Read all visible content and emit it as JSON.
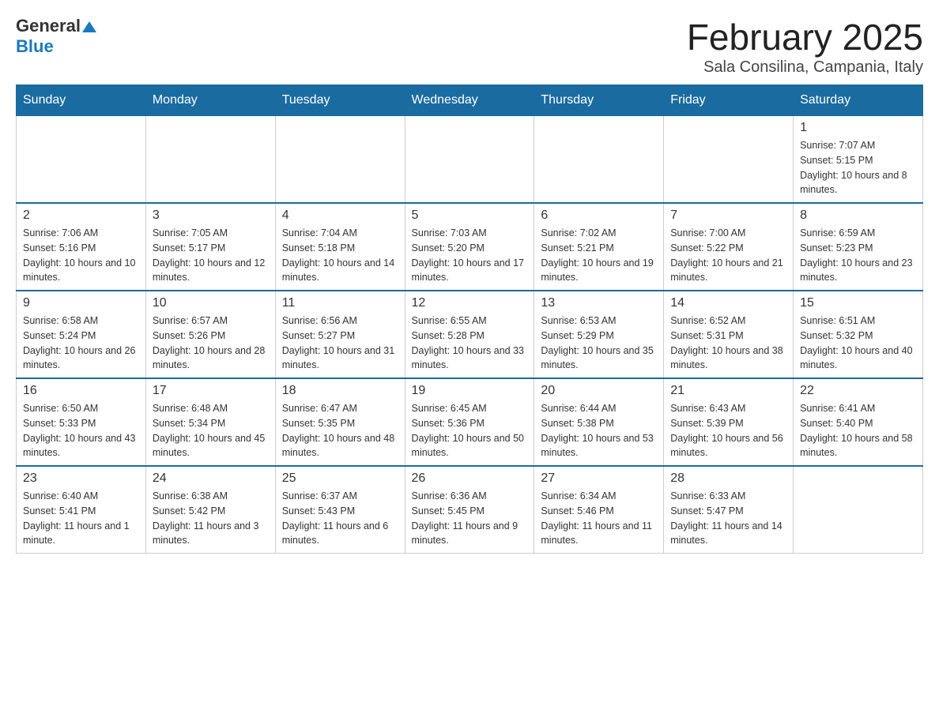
{
  "header": {
    "logo_general": "General",
    "logo_blue": "Blue",
    "month_title": "February 2025",
    "location": "Sala Consilina, Campania, Italy"
  },
  "days_of_week": [
    "Sunday",
    "Monday",
    "Tuesday",
    "Wednesday",
    "Thursday",
    "Friday",
    "Saturday"
  ],
  "weeks": [
    [
      {
        "day": "",
        "info": ""
      },
      {
        "day": "",
        "info": ""
      },
      {
        "day": "",
        "info": ""
      },
      {
        "day": "",
        "info": ""
      },
      {
        "day": "",
        "info": ""
      },
      {
        "day": "",
        "info": ""
      },
      {
        "day": "1",
        "info": "Sunrise: 7:07 AM\nSunset: 5:15 PM\nDaylight: 10 hours and 8 minutes."
      }
    ],
    [
      {
        "day": "2",
        "info": "Sunrise: 7:06 AM\nSunset: 5:16 PM\nDaylight: 10 hours and 10 minutes."
      },
      {
        "day": "3",
        "info": "Sunrise: 7:05 AM\nSunset: 5:17 PM\nDaylight: 10 hours and 12 minutes."
      },
      {
        "day": "4",
        "info": "Sunrise: 7:04 AM\nSunset: 5:18 PM\nDaylight: 10 hours and 14 minutes."
      },
      {
        "day": "5",
        "info": "Sunrise: 7:03 AM\nSunset: 5:20 PM\nDaylight: 10 hours and 17 minutes."
      },
      {
        "day": "6",
        "info": "Sunrise: 7:02 AM\nSunset: 5:21 PM\nDaylight: 10 hours and 19 minutes."
      },
      {
        "day": "7",
        "info": "Sunrise: 7:00 AM\nSunset: 5:22 PM\nDaylight: 10 hours and 21 minutes."
      },
      {
        "day": "8",
        "info": "Sunrise: 6:59 AM\nSunset: 5:23 PM\nDaylight: 10 hours and 23 minutes."
      }
    ],
    [
      {
        "day": "9",
        "info": "Sunrise: 6:58 AM\nSunset: 5:24 PM\nDaylight: 10 hours and 26 minutes."
      },
      {
        "day": "10",
        "info": "Sunrise: 6:57 AM\nSunset: 5:26 PM\nDaylight: 10 hours and 28 minutes."
      },
      {
        "day": "11",
        "info": "Sunrise: 6:56 AM\nSunset: 5:27 PM\nDaylight: 10 hours and 31 minutes."
      },
      {
        "day": "12",
        "info": "Sunrise: 6:55 AM\nSunset: 5:28 PM\nDaylight: 10 hours and 33 minutes."
      },
      {
        "day": "13",
        "info": "Sunrise: 6:53 AM\nSunset: 5:29 PM\nDaylight: 10 hours and 35 minutes."
      },
      {
        "day": "14",
        "info": "Sunrise: 6:52 AM\nSunset: 5:31 PM\nDaylight: 10 hours and 38 minutes."
      },
      {
        "day": "15",
        "info": "Sunrise: 6:51 AM\nSunset: 5:32 PM\nDaylight: 10 hours and 40 minutes."
      }
    ],
    [
      {
        "day": "16",
        "info": "Sunrise: 6:50 AM\nSunset: 5:33 PM\nDaylight: 10 hours and 43 minutes."
      },
      {
        "day": "17",
        "info": "Sunrise: 6:48 AM\nSunset: 5:34 PM\nDaylight: 10 hours and 45 minutes."
      },
      {
        "day": "18",
        "info": "Sunrise: 6:47 AM\nSunset: 5:35 PM\nDaylight: 10 hours and 48 minutes."
      },
      {
        "day": "19",
        "info": "Sunrise: 6:45 AM\nSunset: 5:36 PM\nDaylight: 10 hours and 50 minutes."
      },
      {
        "day": "20",
        "info": "Sunrise: 6:44 AM\nSunset: 5:38 PM\nDaylight: 10 hours and 53 minutes."
      },
      {
        "day": "21",
        "info": "Sunrise: 6:43 AM\nSunset: 5:39 PM\nDaylight: 10 hours and 56 minutes."
      },
      {
        "day": "22",
        "info": "Sunrise: 6:41 AM\nSunset: 5:40 PM\nDaylight: 10 hours and 58 minutes."
      }
    ],
    [
      {
        "day": "23",
        "info": "Sunrise: 6:40 AM\nSunset: 5:41 PM\nDaylight: 11 hours and 1 minute."
      },
      {
        "day": "24",
        "info": "Sunrise: 6:38 AM\nSunset: 5:42 PM\nDaylight: 11 hours and 3 minutes."
      },
      {
        "day": "25",
        "info": "Sunrise: 6:37 AM\nSunset: 5:43 PM\nDaylight: 11 hours and 6 minutes."
      },
      {
        "day": "26",
        "info": "Sunrise: 6:36 AM\nSunset: 5:45 PM\nDaylight: 11 hours and 9 minutes."
      },
      {
        "day": "27",
        "info": "Sunrise: 6:34 AM\nSunset: 5:46 PM\nDaylight: 11 hours and 11 minutes."
      },
      {
        "day": "28",
        "info": "Sunrise: 6:33 AM\nSunset: 5:47 PM\nDaylight: 11 hours and 14 minutes."
      },
      {
        "day": "",
        "info": ""
      }
    ]
  ]
}
